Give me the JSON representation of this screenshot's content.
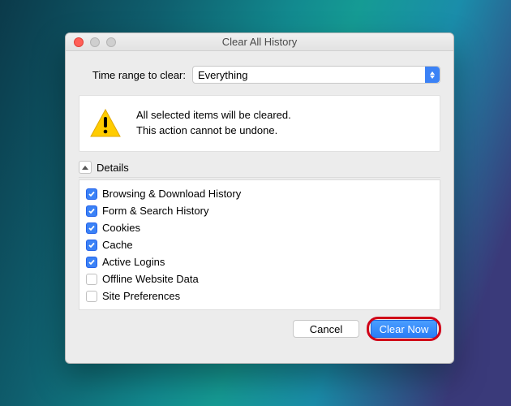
{
  "window": {
    "title": "Clear All History"
  },
  "timeRange": {
    "label": "Time range to clear:",
    "value": "Everything"
  },
  "warning": {
    "line1": "All selected items will be cleared.",
    "line2": "This action cannot be undone."
  },
  "details": {
    "label": "Details",
    "expanded": true,
    "items": [
      {
        "label": "Browsing & Download History",
        "checked": true
      },
      {
        "label": "Form & Search History",
        "checked": true
      },
      {
        "label": "Cookies",
        "checked": true
      },
      {
        "label": "Cache",
        "checked": true
      },
      {
        "label": "Active Logins",
        "checked": true
      },
      {
        "label": "Offline Website Data",
        "checked": false
      },
      {
        "label": "Site Preferences",
        "checked": false
      }
    ]
  },
  "buttons": {
    "cancel": "Cancel",
    "clearNow": "Clear Now"
  }
}
